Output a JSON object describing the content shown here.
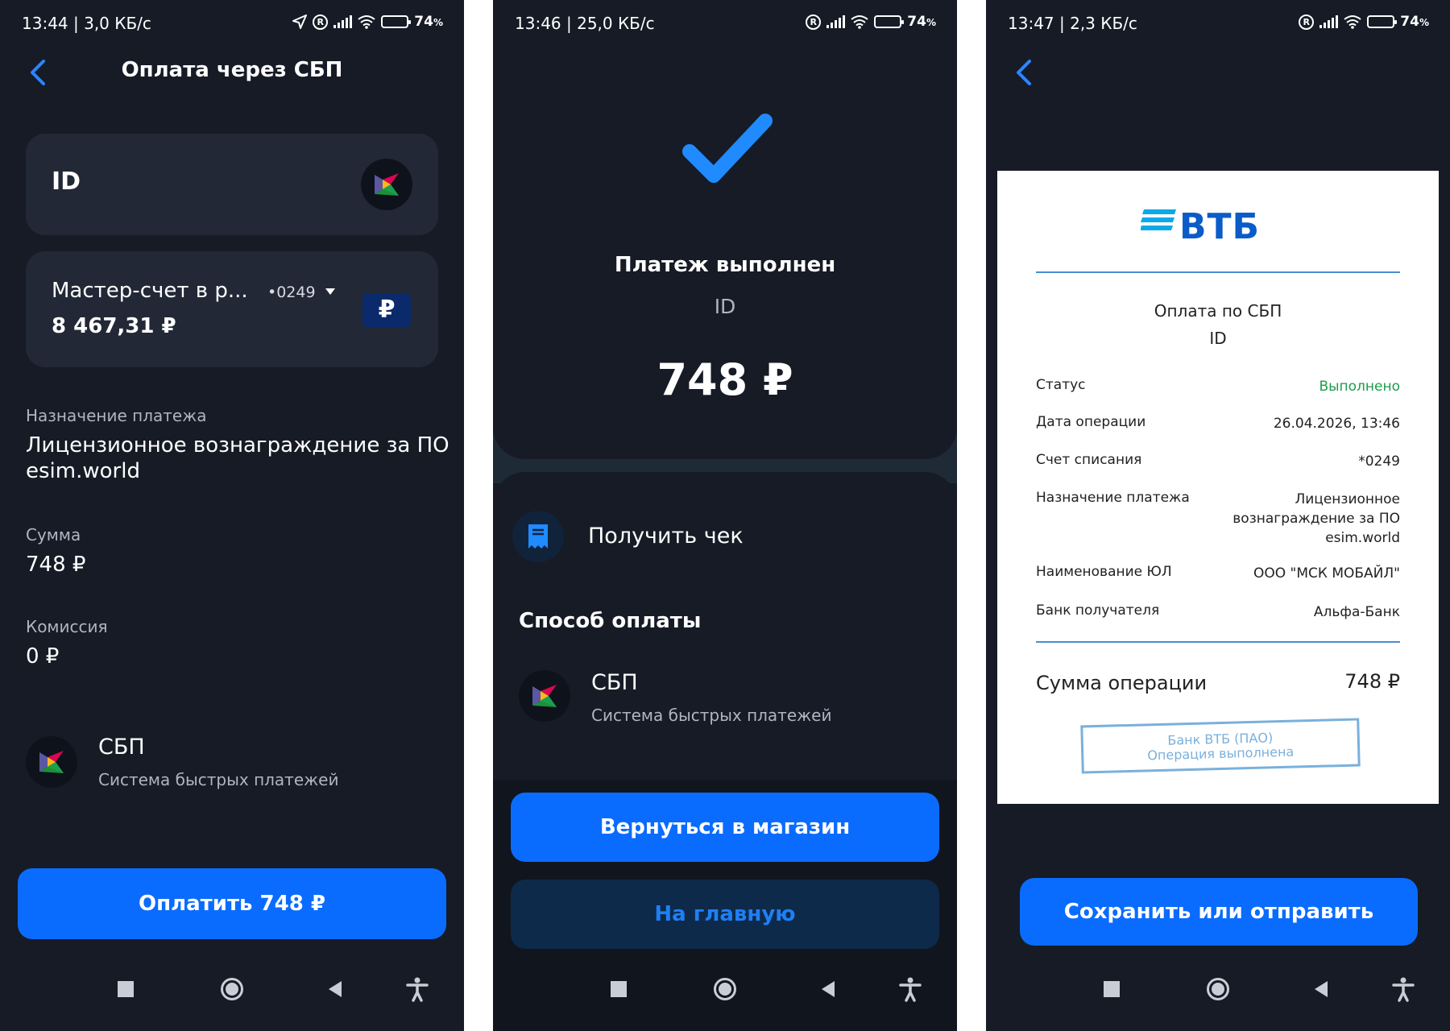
{
  "screen1": {
    "status": {
      "time": "13:44 | 3,0 КБ/с",
      "battery": "74",
      "battery_unit": "%"
    },
    "header": {
      "title": "Оплата через СБП"
    },
    "recipient_card": {
      "label": "ID"
    },
    "account_card": {
      "name": "Мастер-счет в р...",
      "number": "•0249",
      "balance": "8 467,31 ₽",
      "currency_symbol": "₽"
    },
    "purpose": {
      "label": "Назначение платежа",
      "value_line1": "Лицензионное вознаграждение за ПО",
      "value_line2": "esim.world"
    },
    "amount": {
      "label": "Сумма",
      "value": "748 ₽"
    },
    "commission": {
      "label": "Комиссия",
      "value": "0 ₽"
    },
    "method": {
      "name": "СБП",
      "description": "Система быстрых платежей"
    },
    "pay_button": "Оплатить 748 ₽"
  },
  "screen2": {
    "status": {
      "time": "13:46 | 25,0 КБ/с",
      "battery": "74",
      "battery_unit": "%"
    },
    "result": {
      "title": "Платеж выполнен",
      "recipient": "ID",
      "amount": "748 ₽"
    },
    "receipt_action": "Получить чек",
    "method_section": {
      "title": "Способ оплаты",
      "name": "СБП",
      "description": "Система быстрых платежей"
    },
    "back_to_shop_button": "Вернуться в магазин",
    "home_button": "На главную"
  },
  "screen3": {
    "status": {
      "time": "13:47 | 2,3 КБ/с",
      "battery": "74",
      "battery_unit": "%"
    },
    "receipt": {
      "bank_logo": "ВТБ",
      "title": "Оплата по СБП",
      "recipient": "ID",
      "rows": [
        {
          "key": "Статус",
          "value": "Выполнено"
        },
        {
          "key": "Дата операции",
          "value": "26.04.2026, 13:46"
        },
        {
          "key": "Счет списания",
          "value": "*0249"
        },
        {
          "key": "Назначение платежа",
          "value_line1": "Лицензионное",
          "value_line2": "вознаграждение за ПО",
          "value_line3": "esim.world"
        },
        {
          "key": "Наименование ЮЛ",
          "value": "ООО \"МСК МОБАЙЛ\""
        },
        {
          "key": "Банк получателя",
          "value": "Альфа-Банк"
        }
      ],
      "total_label": "Сумма операции",
      "total_value": "748 ₽",
      "stamp_line1": "Банк ВТБ (ПАО)",
      "stamp_line2": "Операция выполнена"
    },
    "save_button": "Сохранить или отправить"
  },
  "colors": {
    "background": "#161b26",
    "card": "#222836",
    "accent": "#0a6cff",
    "secondary_button": "#0d2a4a",
    "status_success": "#1a9e4b",
    "vtb_blue": "#0a5cc8"
  }
}
